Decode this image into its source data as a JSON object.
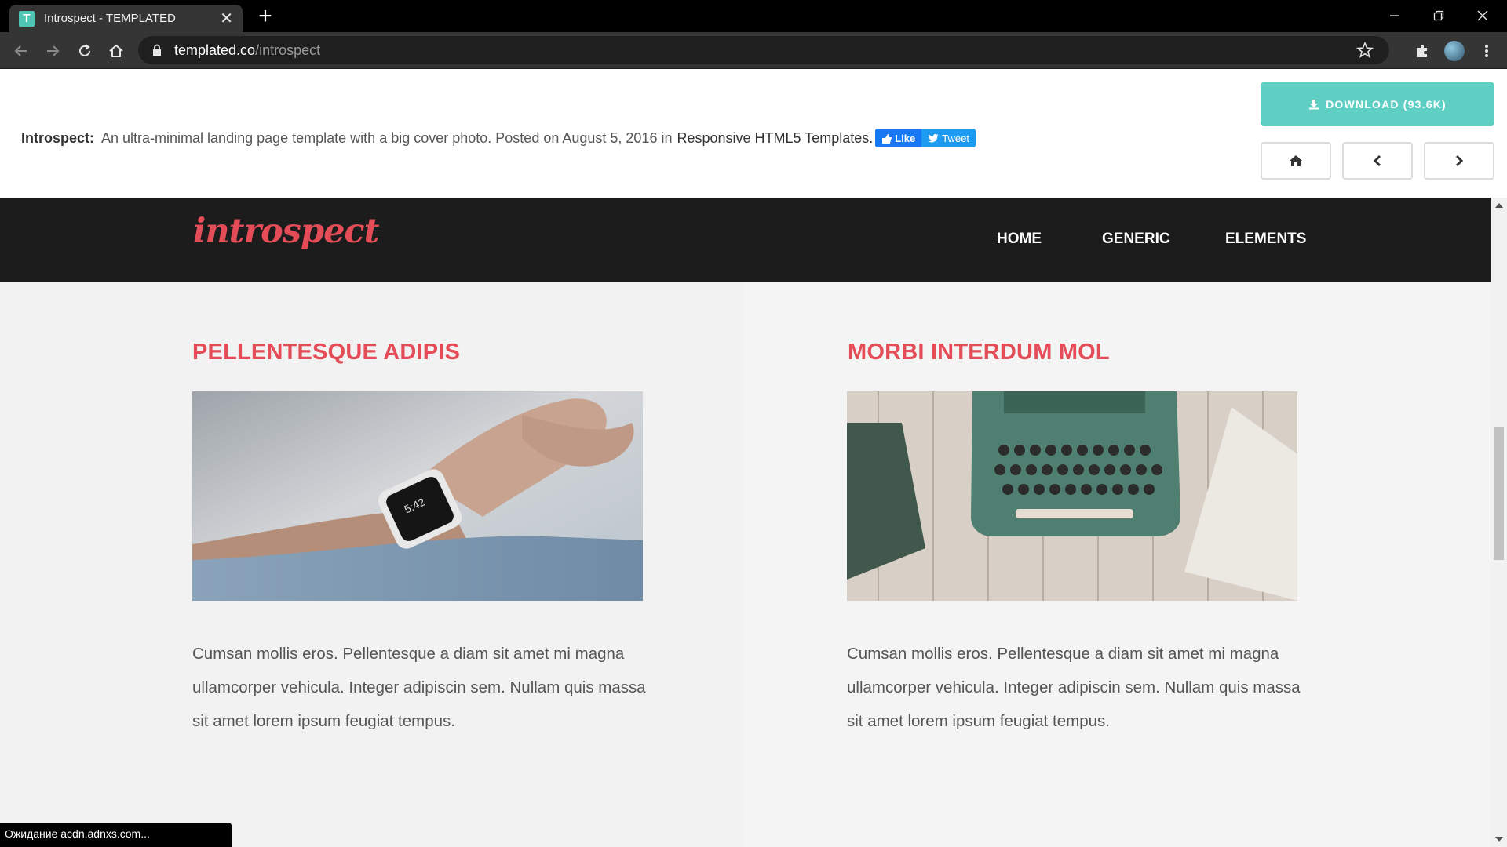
{
  "browser": {
    "tab_icon_letter": "T",
    "tab_title": "Introspect - TEMPLATED",
    "url_host": "templated.co",
    "url_path": "/introspect",
    "status_text": "Ожидание acdn.adnxs.com..."
  },
  "template_bar": {
    "name": "Introspect:",
    "description": "An ultra-minimal landing page template with a big cover photo. Posted on August 5, 2016 in",
    "category_link": "Responsive HTML5 Templates.",
    "like_label": "Like",
    "tweet_label": "Tweet",
    "download_label": "DOWNLOAD (93.6K)"
  },
  "site": {
    "logo": "introspect",
    "nav": [
      "HOME",
      "GENERIC",
      "ELEMENTS"
    ],
    "columns": [
      {
        "title": "PELLENTESQUE ADIPIS",
        "text": "Cumsan mollis eros. Pellentesque a diam sit amet mi magna ullamcorper vehicula. Integer adipiscin sem. Nullam quis massa sit amet lorem ipsum feugiat tempus."
      },
      {
        "title": "MORBI INTERDUM MOL",
        "text": "Cumsan mollis eros. Pellentesque a diam sit amet mi magna ullamcorper vehicula. Integer adipiscin sem. Nullam quis massa sit amet lorem ipsum feugiat tempus."
      }
    ]
  },
  "colors": {
    "accent": "#e44c57",
    "download": "#5fcfc3",
    "header_bg": "#1c1c1c"
  }
}
